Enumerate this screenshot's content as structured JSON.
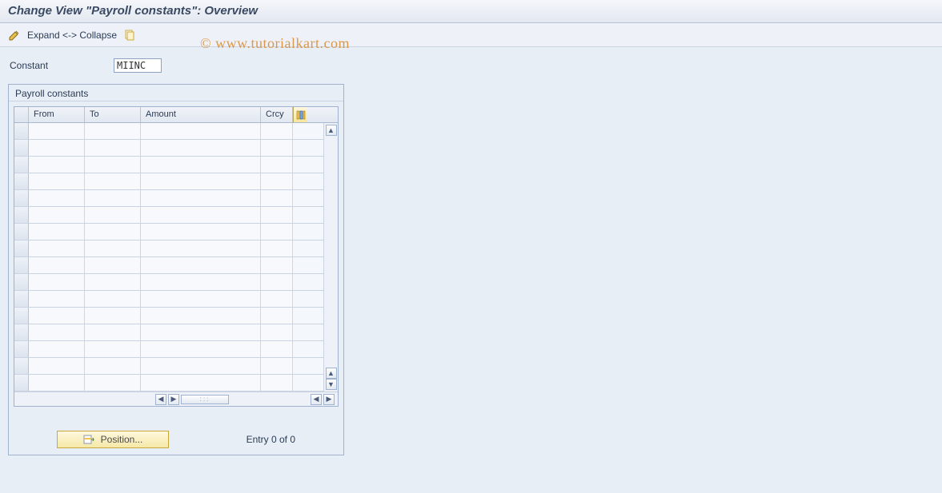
{
  "title": "Change View \"Payroll constants\": Overview",
  "toolbar": {
    "expand_collapse": "Expand <-> Collapse"
  },
  "watermark": "© www.tutorialkart.com",
  "field": {
    "label": "Constant",
    "value": "MIINC"
  },
  "group": {
    "title": "Payroll constants",
    "columns": {
      "from": "From",
      "to": "To",
      "amount": "Amount",
      "crcy": "Crcy"
    },
    "rows": [
      {
        "from": "",
        "to": "",
        "amount": "",
        "crcy": ""
      },
      {
        "from": "",
        "to": "",
        "amount": "",
        "crcy": ""
      },
      {
        "from": "",
        "to": "",
        "amount": "",
        "crcy": ""
      },
      {
        "from": "",
        "to": "",
        "amount": "",
        "crcy": ""
      },
      {
        "from": "",
        "to": "",
        "amount": "",
        "crcy": ""
      },
      {
        "from": "",
        "to": "",
        "amount": "",
        "crcy": ""
      },
      {
        "from": "",
        "to": "",
        "amount": "",
        "crcy": ""
      },
      {
        "from": "",
        "to": "",
        "amount": "",
        "crcy": ""
      },
      {
        "from": "",
        "to": "",
        "amount": "",
        "crcy": ""
      },
      {
        "from": "",
        "to": "",
        "amount": "",
        "crcy": ""
      },
      {
        "from": "",
        "to": "",
        "amount": "",
        "crcy": ""
      },
      {
        "from": "",
        "to": "",
        "amount": "",
        "crcy": ""
      },
      {
        "from": "",
        "to": "",
        "amount": "",
        "crcy": ""
      },
      {
        "from": "",
        "to": "",
        "amount": "",
        "crcy": ""
      },
      {
        "from": "",
        "to": "",
        "amount": "",
        "crcy": ""
      },
      {
        "from": "",
        "to": "",
        "amount": "",
        "crcy": ""
      }
    ]
  },
  "footer": {
    "position_label": "Position...",
    "entry_text": "Entry 0 of 0"
  }
}
